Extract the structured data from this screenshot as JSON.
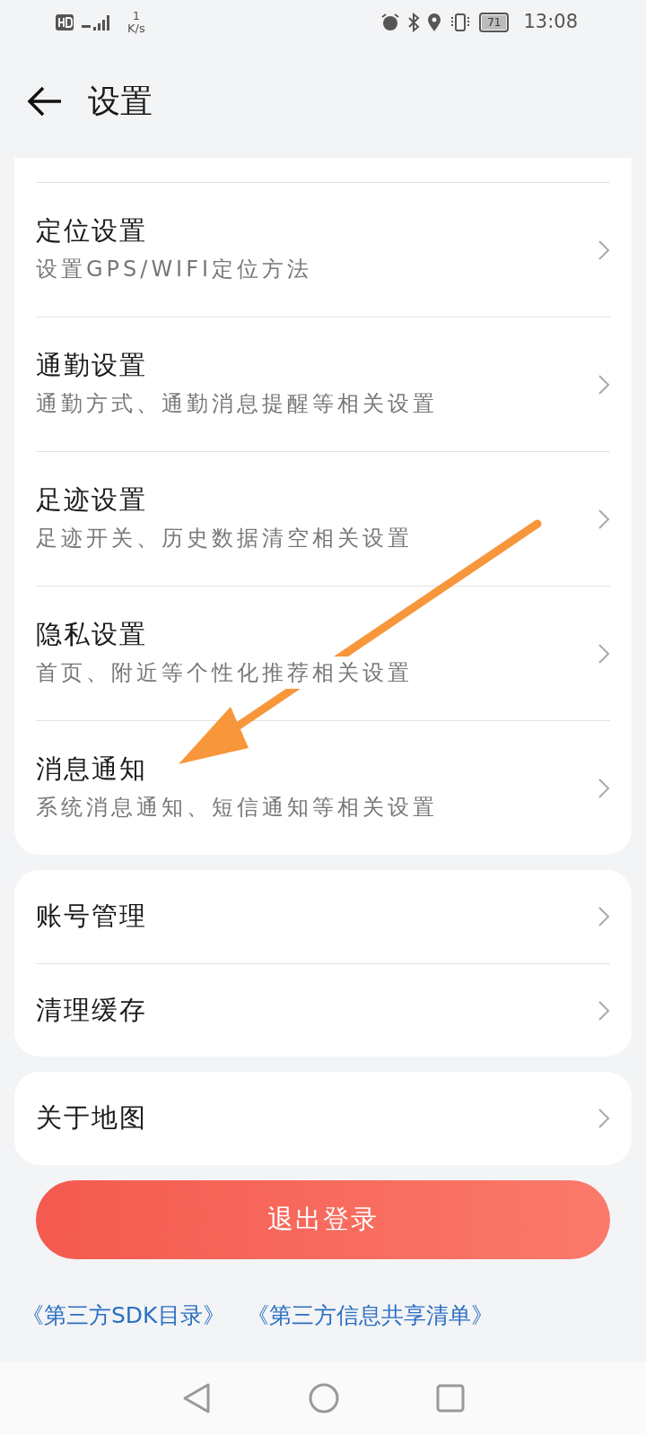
{
  "status_bar": {
    "net_speed_value": "1",
    "net_speed_unit": "K/s",
    "battery": "71",
    "time": "13:08"
  },
  "header": {
    "title": "设置"
  },
  "groups": [
    {
      "items": [
        {
          "title": "定位设置",
          "subtitle": "设置GPS/WIFI定位方法"
        },
        {
          "title": "通勤设置",
          "subtitle": "通勤方式、通勤消息提醒等相关设置"
        },
        {
          "title": "足迹设置",
          "subtitle": "足迹开关、历史数据清空相关设置"
        },
        {
          "title": "隐私设置",
          "subtitle": "首页、附近等个性化推荐相关设置"
        },
        {
          "title": "消息通知",
          "subtitle": "系统消息通知、短信通知等相关设置"
        }
      ]
    },
    {
      "items": [
        {
          "title": "账号管理"
        },
        {
          "title": "清理缓存"
        }
      ]
    },
    {
      "items": [
        {
          "title": "关于地图"
        }
      ]
    }
  ],
  "logout_button": "退出登录",
  "links": [
    "《第三方SDK目录》",
    "《第三方信息共享清单》"
  ]
}
